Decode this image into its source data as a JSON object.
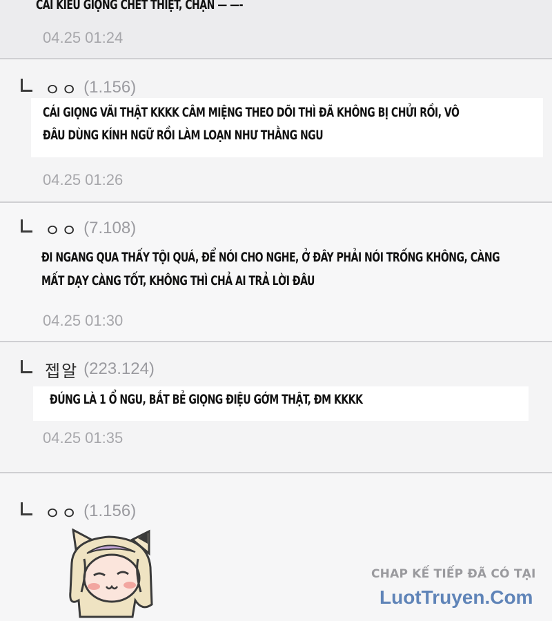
{
  "prev_comment": {
    "text": "CÁI KIỂU GIỌNG CHẾT THIỆT, CHẶN — —-",
    "timestamp": "04.25 01:24"
  },
  "comments": [
    {
      "author": "ㅇㅇ",
      "ip": "(1.156)",
      "text_lines": [
        "CÁI GIỌNG VÃI THẬT KKKK CÂM MIỆNG THEO DÕI THÌ ĐÃ KHÔNG BỊ CHỬI RỒI, VÔ",
        "ĐÂU DÙNG KÍNH NGỮ RỒI LÀM LOẠN NHƯ THẰNG NGU"
      ],
      "timestamp": "04.25 01:26"
    },
    {
      "author": "ㅇㅇ",
      "ip": "(7.108)",
      "text_lines": [
        "ĐI NGANG QUA THẤY TỘI QUÁ, ĐỂ NÓI CHO NGHE, Ở ĐÂY PHẢI NÓI TRỐNG KHÔNG, CÀNG",
        "MẤT DẠY CÀNG TỐT, KHÔNG THÌ CHẢ AI TRẢ LỜI ĐÂU"
      ],
      "timestamp": "04.25 01:30"
    },
    {
      "author": "젭알",
      "ip": "(223.124)",
      "text_lines": [
        "ĐÚNG LÀ 1 Ổ NGU, BẮT BẺ GIỌNG ĐIỆU GỚM THẬT, ĐM KKKK"
      ],
      "timestamp": "04.25 01:35"
    },
    {
      "author": "ㅇㅇ",
      "ip": "(1.156)"
    }
  ],
  "promo": {
    "line1": "CHAP KẾ TIẾP ĐÃ CÓ TẠI",
    "line2": "LuotTruyen.Com"
  },
  "colors": {
    "promo_link": "#5f84b8",
    "timestamp": "#a7a7ab",
    "divider": "#cfcfd2"
  }
}
